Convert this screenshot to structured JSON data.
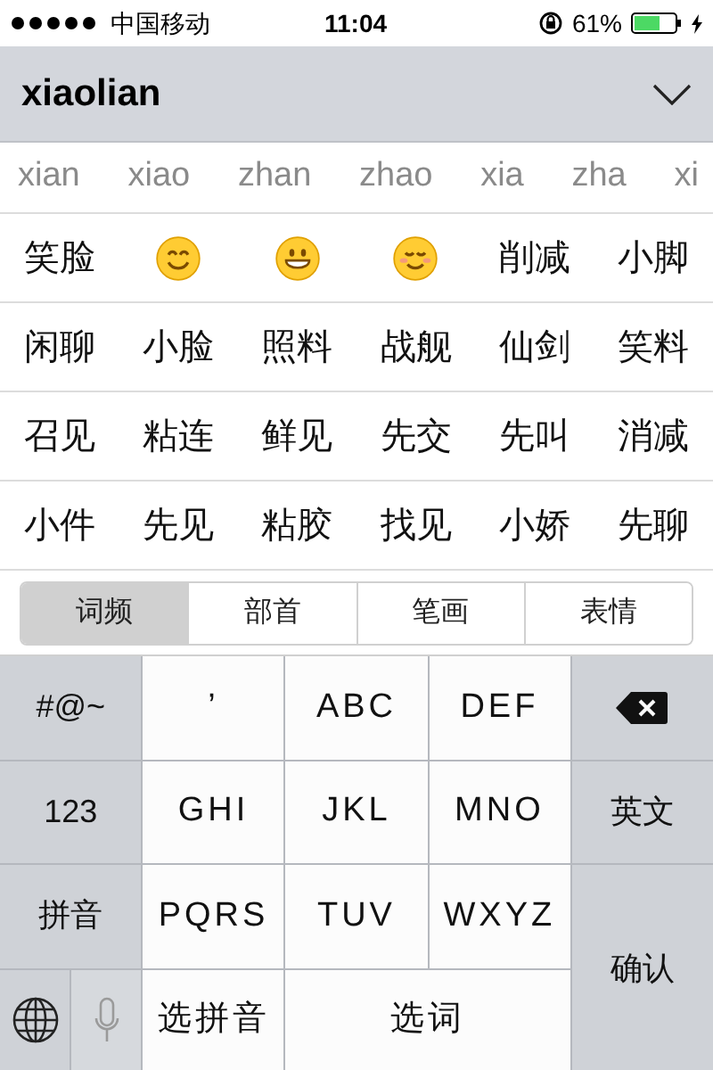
{
  "status_bar": {
    "carrier": "中国移动",
    "time": "11:04",
    "battery_text": "61%"
  },
  "composition": {
    "text": "xiaolian"
  },
  "pinyin_options": [
    "xian",
    "xiao",
    "zhan",
    "zhao",
    "xia",
    "zha",
    "xi"
  ],
  "candidate_rows": [
    [
      {
        "kind": "text",
        "text": "笑脸"
      },
      {
        "kind": "smile"
      },
      {
        "kind": "grin"
      },
      {
        "kind": "blush"
      },
      {
        "kind": "text",
        "text": "削减"
      },
      {
        "kind": "text",
        "text": "小脚"
      }
    ],
    [
      {
        "kind": "text",
        "text": "闲聊"
      },
      {
        "kind": "text",
        "text": "小脸"
      },
      {
        "kind": "text",
        "text": "照料"
      },
      {
        "kind": "text",
        "text": "战舰"
      },
      {
        "kind": "text",
        "text": "仙剑"
      },
      {
        "kind": "text",
        "text": "笑料"
      }
    ],
    [
      {
        "kind": "text",
        "text": "召见"
      },
      {
        "kind": "text",
        "text": "粘连"
      },
      {
        "kind": "text",
        "text": "鲜见"
      },
      {
        "kind": "text",
        "text": "先交"
      },
      {
        "kind": "text",
        "text": "先叫"
      },
      {
        "kind": "text",
        "text": "消减"
      }
    ],
    [
      {
        "kind": "text",
        "text": "小件"
      },
      {
        "kind": "text",
        "text": "先见"
      },
      {
        "kind": "text",
        "text": "粘胶"
      },
      {
        "kind": "text",
        "text": "找见"
      },
      {
        "kind": "text",
        "text": "小娇"
      },
      {
        "kind": "text",
        "text": "先聊"
      }
    ]
  ],
  "filter_tabs": [
    {
      "label": "词频",
      "selected": true
    },
    {
      "label": "部首",
      "selected": false
    },
    {
      "label": "笔画",
      "selected": false
    },
    {
      "label": "表情",
      "selected": false
    }
  ],
  "keys": [
    {
      "kind": "function",
      "label": "#@~"
    },
    {
      "kind": "letter",
      "label": "’"
    },
    {
      "kind": "letter",
      "label": "ABC"
    },
    {
      "kind": "letter",
      "label": "DEF"
    },
    {
      "kind": "backspace"
    },
    {
      "kind": "function",
      "label": "123"
    },
    {
      "kind": "letter",
      "label": "GHI"
    },
    {
      "kind": "letter",
      "label": "JKL"
    },
    {
      "kind": "letter",
      "label": "MNO"
    },
    {
      "kind": "function",
      "label": "英文"
    },
    {
      "kind": "function",
      "label": "拼音"
    },
    {
      "kind": "letter",
      "label": "PQRS"
    },
    {
      "kind": "letter",
      "label": "TUV"
    },
    {
      "kind": "letter",
      "label": "WXYZ"
    },
    {
      "kind": "function",
      "label": "确认"
    },
    {
      "kind": "globe"
    },
    {
      "kind": "mic"
    },
    {
      "kind": "letter",
      "label": "选拼音"
    },
    {
      "kind": "letter",
      "label": "选词"
    }
  ]
}
